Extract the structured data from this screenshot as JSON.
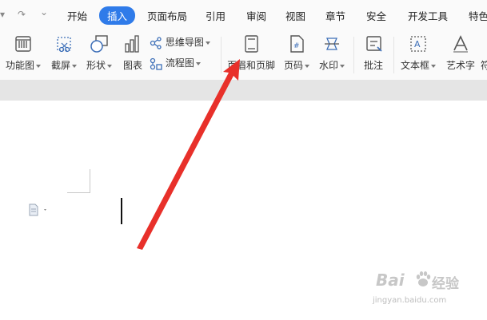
{
  "quick_access": {
    "dropdown_glyph": "▾",
    "redo_glyph": "↷",
    "more_glyph": "⌄"
  },
  "tabs": [
    {
      "label": "开始"
    },
    {
      "label": "插入",
      "active": true
    },
    {
      "label": "页面布局"
    },
    {
      "label": "引用"
    },
    {
      "label": "审阅"
    },
    {
      "label": "视图"
    },
    {
      "label": "章节"
    },
    {
      "label": "安全"
    },
    {
      "label": "开发工具"
    },
    {
      "label": "特色"
    }
  ],
  "ribbon": {
    "function_chart": "功能图",
    "screenshot": "截屏",
    "shapes": "形状",
    "chart": "图表",
    "mind_map": "思维导图",
    "flowchart": "流程图",
    "header_footer": "页眉和页脚",
    "page_number": "页码",
    "watermark": "水印",
    "comment": "批注",
    "text_box": "文本框",
    "word_art": "艺术字",
    "more": "符"
  },
  "watermark": {
    "brand": "Bai",
    "brand_cn": "经验",
    "url": "jingyan.baidu.com"
  },
  "colors": {
    "accent": "#2f7be9",
    "arrow": "#e8302a",
    "icon_blue": "#3d6fb8"
  },
  "icons": [
    "function-chart-icon",
    "screenshot-icon",
    "shapes-icon",
    "chart-icon",
    "mind-map-icon",
    "flowchart-icon",
    "header-footer-icon",
    "page-number-icon",
    "watermark-icon",
    "comment-icon",
    "text-box-icon",
    "word-art-icon",
    "paragraph-icon",
    "red-arrow"
  ]
}
